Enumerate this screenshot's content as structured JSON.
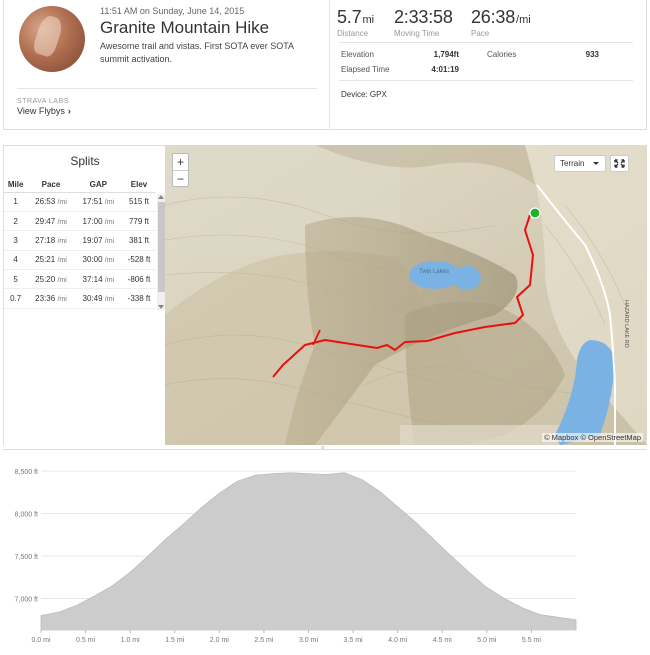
{
  "activity": {
    "datetime": "11:51 AM on Sunday, June 14, 2015",
    "title": "Granite Mountain Hike",
    "description": "Awesome trail and vistas. First SOTA ever SOTA summit activation.",
    "labs_label": "STRAVA LABS",
    "flyby_link": "View Flybys",
    "flyby_chevron": "›"
  },
  "stats": {
    "distance": {
      "value": "5.7",
      "unit": "mi",
      "label": "Distance"
    },
    "moving_time": {
      "value": "2:33:58",
      "label": "Moving Time"
    },
    "pace": {
      "value": "26:38",
      "unit": "/mi",
      "label": "Pace"
    },
    "elevation_label": "Elevation",
    "elevation_value": "1,794ft",
    "calories_label": "Calories",
    "calories_value": "933",
    "elapsed_label": "Elapsed Time",
    "elapsed_value": "4:01:19",
    "device": "Device: GPX"
  },
  "splits": {
    "title": "Splits",
    "headers": [
      "Mile",
      "Pace",
      "GAP",
      "Elev"
    ],
    "pace_unit": "/mi",
    "rows": [
      {
        "mile": "1",
        "pace": "26:53",
        "gap": "17:51",
        "elev": "515 ft"
      },
      {
        "mile": "2",
        "pace": "29:47",
        "gap": "17:00",
        "elev": "779 ft"
      },
      {
        "mile": "3",
        "pace": "27:18",
        "gap": "19:07",
        "elev": "381 ft"
      },
      {
        "mile": "4",
        "pace": "25:21",
        "gap": "30:00",
        "elev": "-528 ft"
      },
      {
        "mile": "5",
        "pace": "25:20",
        "gap": "37:14",
        "elev": "-806 ft"
      },
      {
        "mile": "0.7",
        "pace": "23:36",
        "gap": "30:49",
        "elev": "-338 ft"
      }
    ]
  },
  "map": {
    "zoom_in": "+",
    "zoom_out": "−",
    "terrain_label": "Terrain",
    "attribution": "© Mapbox © OpenStreetMap",
    "lake_label": "Twin Lakes",
    "road_label": "HAZARD LAKE RD",
    "route_color": "#e8100f",
    "start_color": "#1fae2d",
    "water_color": "#7ab3e3"
  },
  "chart_data": {
    "type": "area",
    "xlabel": "",
    "ylabel": "",
    "x_ticks": [
      "0.0 mi",
      "0.5 mi",
      "1.0 mi",
      "1.5 mi",
      "2.0 mi",
      "2.5 mi",
      "3.0 mi",
      "3.5 mi",
      "4.0 mi",
      "4.5 mi",
      "5.0 mi",
      "5.5 mi"
    ],
    "y_ticks": [
      "7,000 ft",
      "7,500 ft",
      "8,000 ft",
      "8,500 ft"
    ],
    "xlim": [
      0,
      6.0
    ],
    "ylim": [
      6630,
      8560
    ],
    "fill_color": "#cccccc",
    "x": [
      0.0,
      0.2,
      0.4,
      0.6,
      0.8,
      1.0,
      1.2,
      1.4,
      1.6,
      1.8,
      2.0,
      2.2,
      2.4,
      2.6,
      2.8,
      3.0,
      3.2,
      3.4,
      3.6,
      3.8,
      4.0,
      4.2,
      4.4,
      4.6,
      4.8,
      5.0,
      5.2,
      5.4,
      5.6,
      5.8,
      6.0
    ],
    "y": [
      6800,
      6840,
      6920,
      7030,
      7150,
      7310,
      7500,
      7700,
      7880,
      8070,
      8240,
      8380,
      8450,
      8470,
      8480,
      8470,
      8460,
      8480,
      8400,
      8260,
      8080,
      7900,
      7700,
      7500,
      7310,
      7130,
      7000,
      6890,
      6810,
      6780,
      6750
    ]
  }
}
